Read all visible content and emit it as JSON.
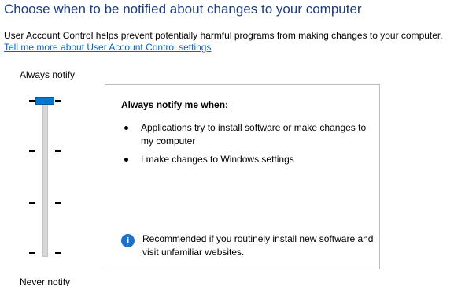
{
  "header": {
    "title": "Choose when to be notified about changes to your computer",
    "description": "User Account Control helps prevent potentially harmful programs from making changes to your computer.",
    "link": "Tell me more about User Account Control settings"
  },
  "slider": {
    "top_label": "Always notify",
    "bottom_label": "Never notify",
    "levels": 4,
    "selected_level": 4,
    "selected_level_name": "Always notify"
  },
  "info_panel": {
    "title": "Always notify me when:",
    "bullets": [
      "Applications try to install software or make changes to my computer",
      "I make changes to Windows settings"
    ],
    "recommendation_icon": "info-icon",
    "recommendation": "Recommended if you routinely install new software and visit unfamiliar websites."
  },
  "colors": {
    "heading": "#1f3d7a",
    "link": "#0066cc",
    "slider_thumb": "#0078d7",
    "info_icon": "#1a73c9"
  }
}
